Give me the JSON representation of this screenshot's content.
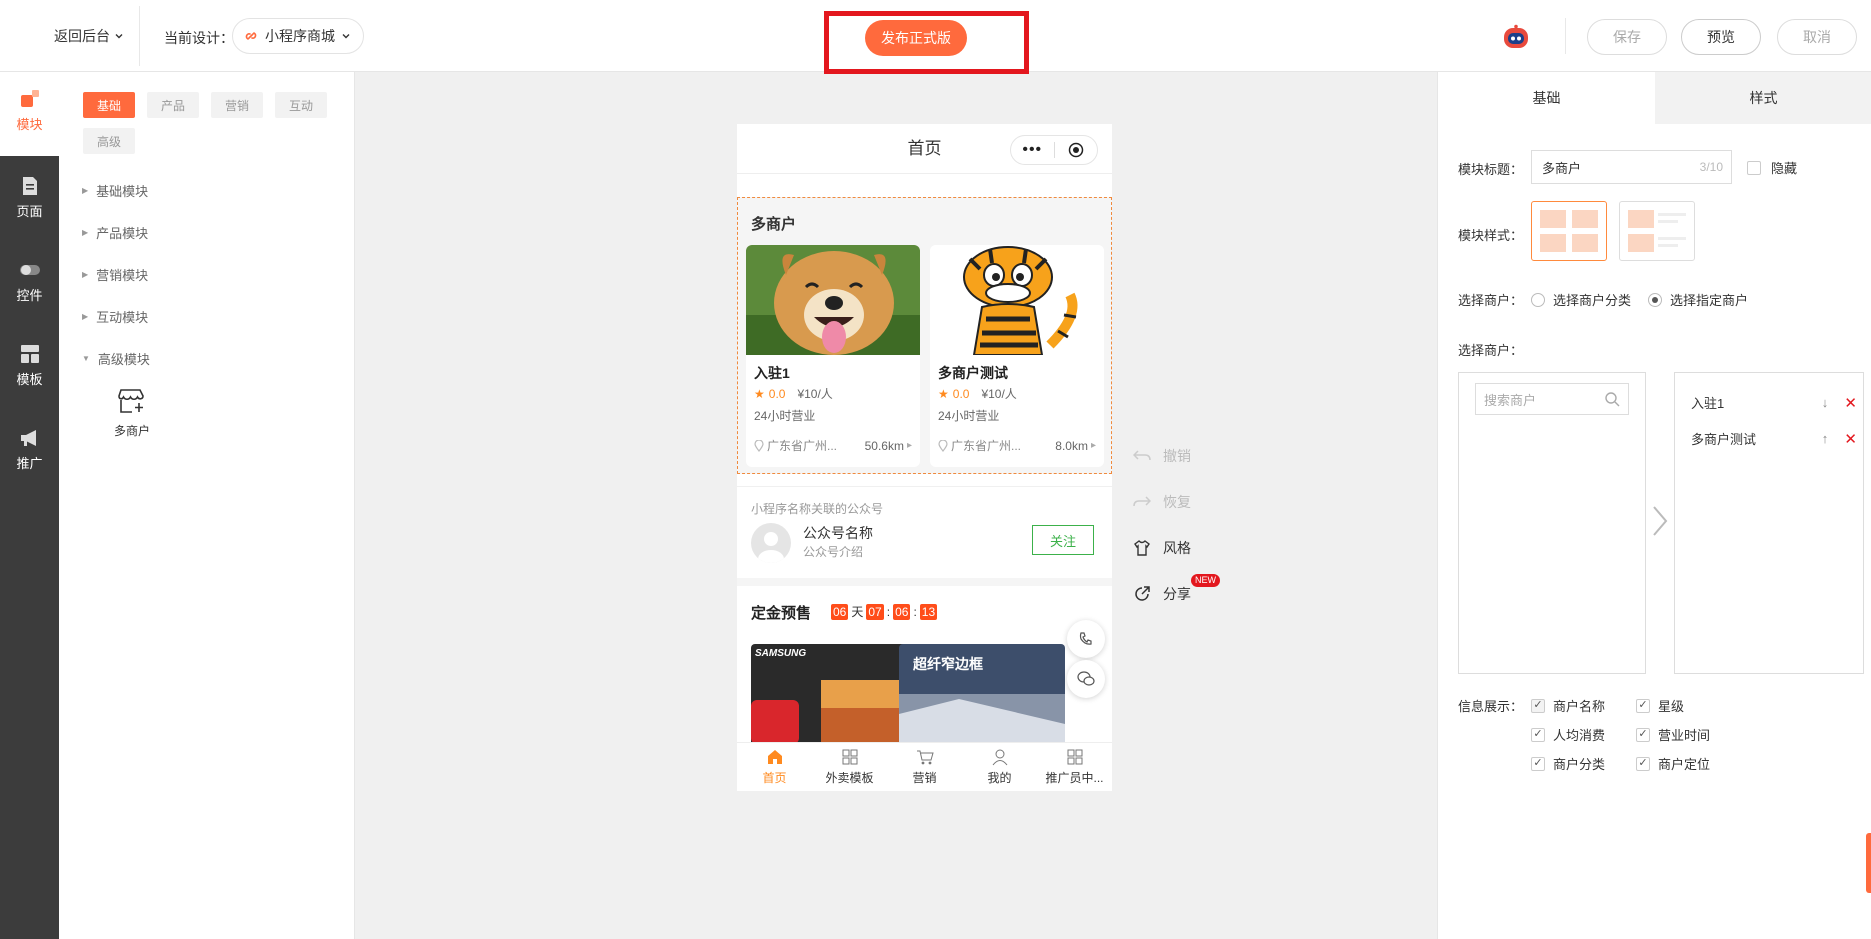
{
  "topbar": {
    "back_label": "返回后台",
    "current_design_label": "当前设计：",
    "design_name": "小程序商城",
    "publish_label": "发布正式版",
    "save_label": "保存",
    "preview_label": "预览",
    "cancel_label": "取消"
  },
  "rail": {
    "items": [
      {
        "label": "模块",
        "icon": "module-icon"
      },
      {
        "label": "页面",
        "icon": "page-icon"
      },
      {
        "label": "控件",
        "icon": "toggle-icon"
      },
      {
        "label": "模板",
        "icon": "template-icon"
      },
      {
        "label": "推广",
        "icon": "megaphone-icon"
      }
    ]
  },
  "module_panel": {
    "tags": [
      "基础",
      "产品",
      "营销",
      "互动",
      "高级"
    ],
    "categories": [
      "基础模块",
      "产品模块",
      "营销模块",
      "互动模块",
      "高级模块"
    ],
    "tile_label": "多商户"
  },
  "phone": {
    "page_title": "首页",
    "capsule_dots": "•••",
    "merchant_block": {
      "title": "多商户",
      "cards": [
        {
          "name": "入驻1",
          "score": "0.0",
          "price": "¥10/人",
          "hours": "24小时营业",
          "location": "广东省广州...",
          "distance": "50.6km"
        },
        {
          "name": "多商户测试",
          "score": "0.0",
          "price": "¥10/人",
          "hours": "24小时营业",
          "location": "广东省广州...",
          "distance": "8.0km"
        }
      ]
    },
    "gzh": {
      "hint": "小程序名称关联的公众号",
      "name": "公众号名称",
      "intro": "公众号介绍",
      "follow_label": "关注"
    },
    "presale": {
      "title": "定金预售",
      "countdown": {
        "days": "06",
        "day_unit": "天",
        "hours": "07",
        "minutes": "06",
        "seconds": "13",
        "sep": ":"
      },
      "img1_brand": "SAMSUNG",
      "img2_text": "超纤窄边框"
    },
    "tabbar": [
      "首页",
      "外卖模板",
      "营销",
      "我的",
      "推广员中..."
    ]
  },
  "tools": {
    "undo": "撤销",
    "redo": "恢复",
    "style": "风格",
    "share": "分享",
    "new_badge": "NEW"
  },
  "right_panel": {
    "tab_basic": "基础",
    "tab_style": "样式",
    "title_label": "模块标题：",
    "title_value": "多商户",
    "title_count": "3/10",
    "hide_label": "隐藏",
    "style_label": "模块样式：",
    "select_label": "选择商户：",
    "radio_category": "选择商户分类",
    "radio_specific": "选择指定商户",
    "select_merchant_label": "选择商户：",
    "search_placeholder": "搜索商户",
    "selected": [
      {
        "name": "入驻1",
        "move": "↓",
        "remove": "✕"
      },
      {
        "name": "多商户测试",
        "move": "↑",
        "remove": "✕"
      }
    ],
    "info_label": "信息展示：",
    "info_options": [
      "商户名称",
      "星级",
      "人均消费",
      "营业时间",
      "商户分类",
      "商户定位"
    ]
  },
  "colors": {
    "accent": "#ff6a3d",
    "highlight_border": "#e3171e",
    "follow_green": "#3cb14a"
  }
}
